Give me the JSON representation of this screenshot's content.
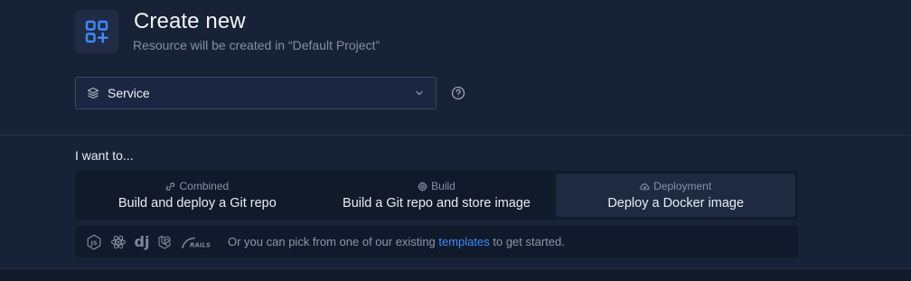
{
  "header": {
    "icon": "grid-plus-icon",
    "title": "Create new",
    "subtitle": "Resource will be created in “Default Project”"
  },
  "resource_select": {
    "icon": "layers-icon",
    "value": "Service",
    "chevron": "chevron-down-icon"
  },
  "help_icon": "question-circle-icon",
  "want": {
    "label": "I want to...",
    "tabs": [
      {
        "category": "Combined",
        "icon": "link-icon",
        "label": "Build and deploy a Git repo",
        "active": false
      },
      {
        "category": "Build",
        "icon": "gear-icon",
        "label": "Build a Git repo and store image",
        "active": false
      },
      {
        "category": "Deployment",
        "icon": "cloud-upload-icon",
        "label": "Deploy a Docker image",
        "active": true
      }
    ]
  },
  "templates": {
    "logos": [
      "nodejs-icon",
      "react-icon",
      "django-icon",
      "laravel-icon",
      "rails-icon"
    ],
    "django_text": "dj",
    "prefix": "Or you can pick from one of our existing ",
    "link": "templates",
    "suffix": " to get started."
  },
  "colors": {
    "background": "#172236",
    "accent": "#3d8bfd",
    "muted_text": "#8390a4",
    "panel": "#111a2a"
  }
}
